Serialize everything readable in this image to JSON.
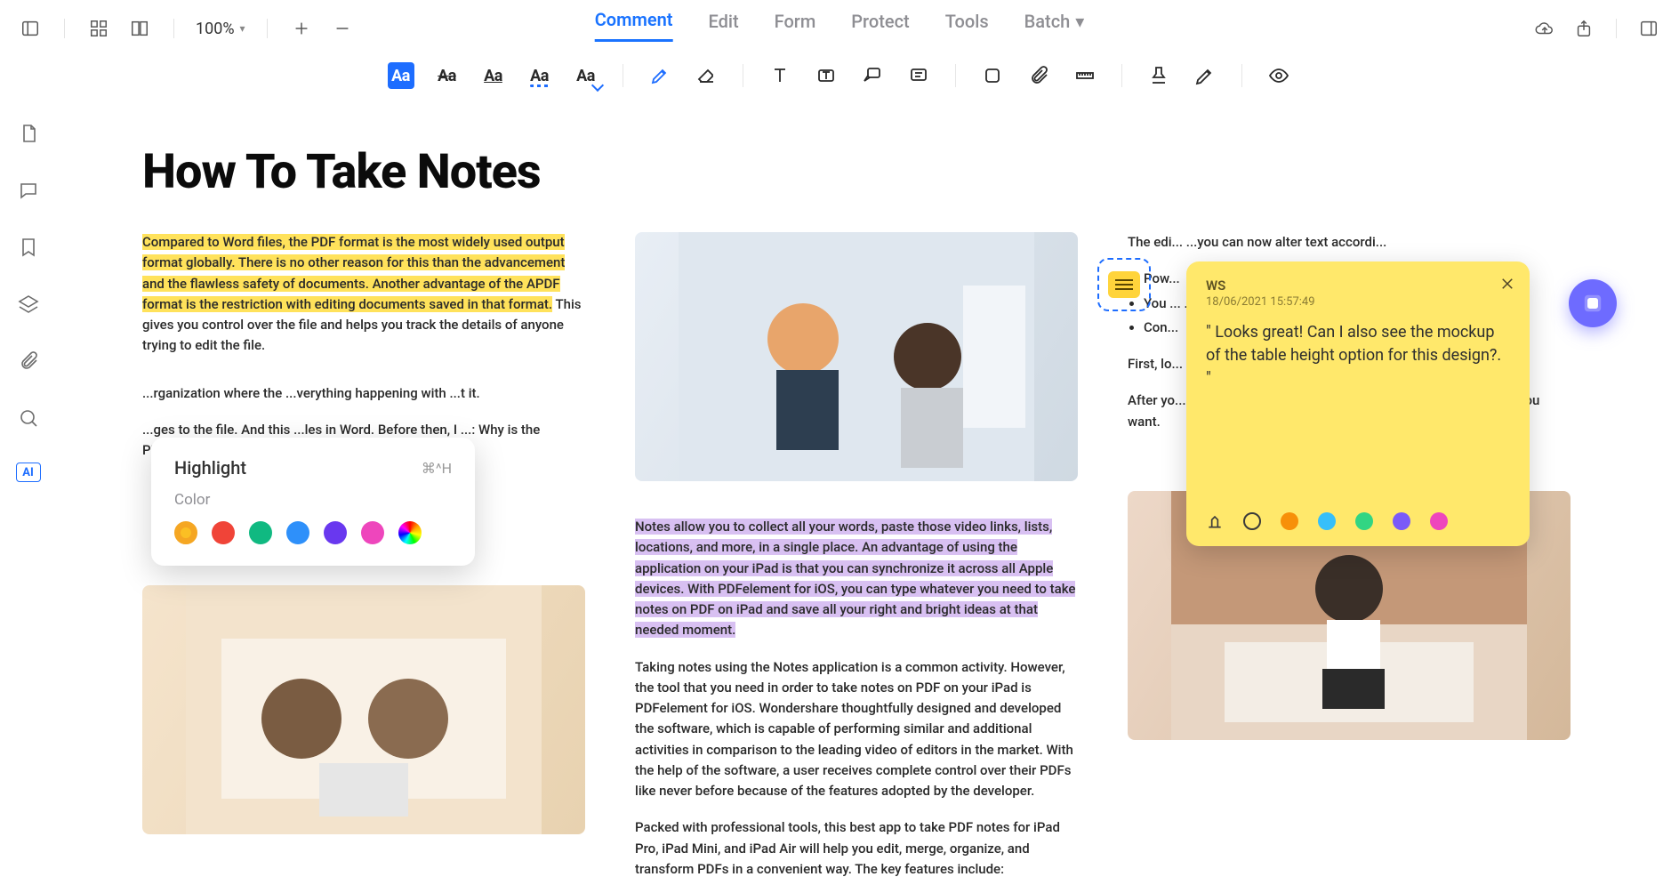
{
  "topbar": {
    "zoom": "100%",
    "tabs": [
      "Comment",
      "Edit",
      "Form",
      "Protect",
      "Tools",
      "Batch"
    ],
    "active_tab": "Comment"
  },
  "toolbar": {
    "text_styles": [
      "Aa",
      "Aa",
      "Aa",
      "Aa",
      "Aa"
    ]
  },
  "sidebar": {
    "items": [
      "page",
      "comment",
      "bookmark",
      "layers",
      "attachment",
      "search",
      "ai"
    ],
    "ai_label": "AI"
  },
  "document": {
    "title": "How To Take Notes",
    "col1": {
      "p1_highlighted": "Compared to Word files, the PDF format is the most widely used output format globally. There is no other reason for this than the advancement and the flawless safety of documents. Another advantage of the APDF format is the restriction with editing documents saved in that format.",
      "p1_rest": " This gives you control over the file and helps you track the details of anyone trying to edit the file.",
      "p2": "...rganization where the ...verything happening with ...t it.",
      "p3": "...ges to the file. And this ...les in Word. Before then, I ...: Why is the PDFelement ..."
    },
    "col2": {
      "p1_highlighted": "Notes allow you to collect all your words, paste those video links, lists, locations, and more, in a single place. An advantage of using the application on your iPad is that you can synchronize it across all Apple devices. With PDFelement for iOS, you can type whatever you need to take notes on PDF on iPad and save all your right and bright ideas at that needed moment.",
      "p1_link": "PDFelement for iOS",
      "p2": "Taking notes using the Notes application is a common activity. However, the tool that you need in order to take notes on PDF on your iPad is PDFelement for iOS. Wondershare thoughtfully designed and developed the software, which is capable of performing similar and additional activities in comparison to the leading video of editors in the market. With the help of the software, a user receives complete control over their PDFs like never before because of the features adopted by the developer.",
      "p3": "Packed with professional tools, this best app to take PDF notes for iPad Pro, iPad Mini, and iPad Air will help you edit, merge, organize, and transform PDFs in a convenient way. The key features include:"
    },
    "col3": {
      "p1": "The edi... ...you can now alter text accordi...",
      "bullets": [
        "Pow...",
        "You ... ...r feature.",
        "Con..."
      ],
      "p2": "First, lo... ...pen on your iPad. You will nov... ...take notes on.",
      "p3": "After yo... ...screen. There you will see all c... ...annotating tool as you want."
    }
  },
  "highlight_popover": {
    "title": "Highlight",
    "shortcut": "⌘^H",
    "subtitle": "Color",
    "colors": [
      "#fbbf24",
      "#f04438",
      "#10b981",
      "#2e90fa",
      "#6938ef",
      "#ee46bc",
      "rainbow"
    ]
  },
  "sticky_note": {
    "author": "WS",
    "timestamp": "18/06/2021 15:57:49",
    "body": "\" Looks great! Can I also see the mockup of the table height option for this design?. \"",
    "colors": [
      "outline",
      "#f79009",
      "#36bffa",
      "#32d583",
      "#7a5af8",
      "#ee46bc"
    ]
  }
}
